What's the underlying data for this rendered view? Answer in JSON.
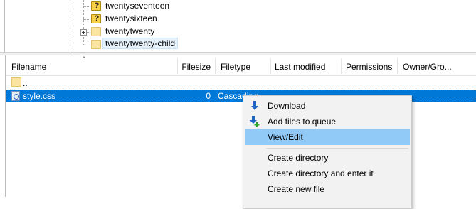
{
  "tree": {
    "items": [
      {
        "label": "twentyseventeen",
        "icon": "question-folder-icon",
        "expandable": false
      },
      {
        "label": "twentysixteen",
        "icon": "question-folder-icon",
        "expandable": false
      },
      {
        "label": "twentytwenty",
        "icon": "folder-icon",
        "expandable": true
      },
      {
        "label": "twentytwenty-child",
        "icon": "folder-icon",
        "expandable": false,
        "selected": true
      }
    ]
  },
  "list": {
    "columns": {
      "filename": "Filename",
      "filesize": "Filesize",
      "filetype": "Filetype",
      "last_modified": "Last modified",
      "permissions": "Permissions",
      "owner_group": "Owner/Gro..."
    },
    "rows": [
      {
        "name": "..",
        "size": "",
        "type": "",
        "icon": "folder-icon"
      },
      {
        "name": "style.css",
        "size": "0",
        "type": "Cascading",
        "icon": "css-file-icon",
        "selected": true
      }
    ]
  },
  "context_menu": {
    "items": [
      {
        "label": "Download",
        "icon": "download-arrow-icon"
      },
      {
        "label": "Add files to queue",
        "icon": "add-to-queue-icon"
      },
      {
        "label": "View/Edit",
        "highlighted": true
      },
      {
        "label": "Create directory"
      },
      {
        "label": "Create directory and enter it"
      },
      {
        "label": "Create new file"
      }
    ]
  },
  "colors": {
    "selection": "#0078d7",
    "menu_highlight": "#91c9f7",
    "folder": "#fbe3a0"
  }
}
